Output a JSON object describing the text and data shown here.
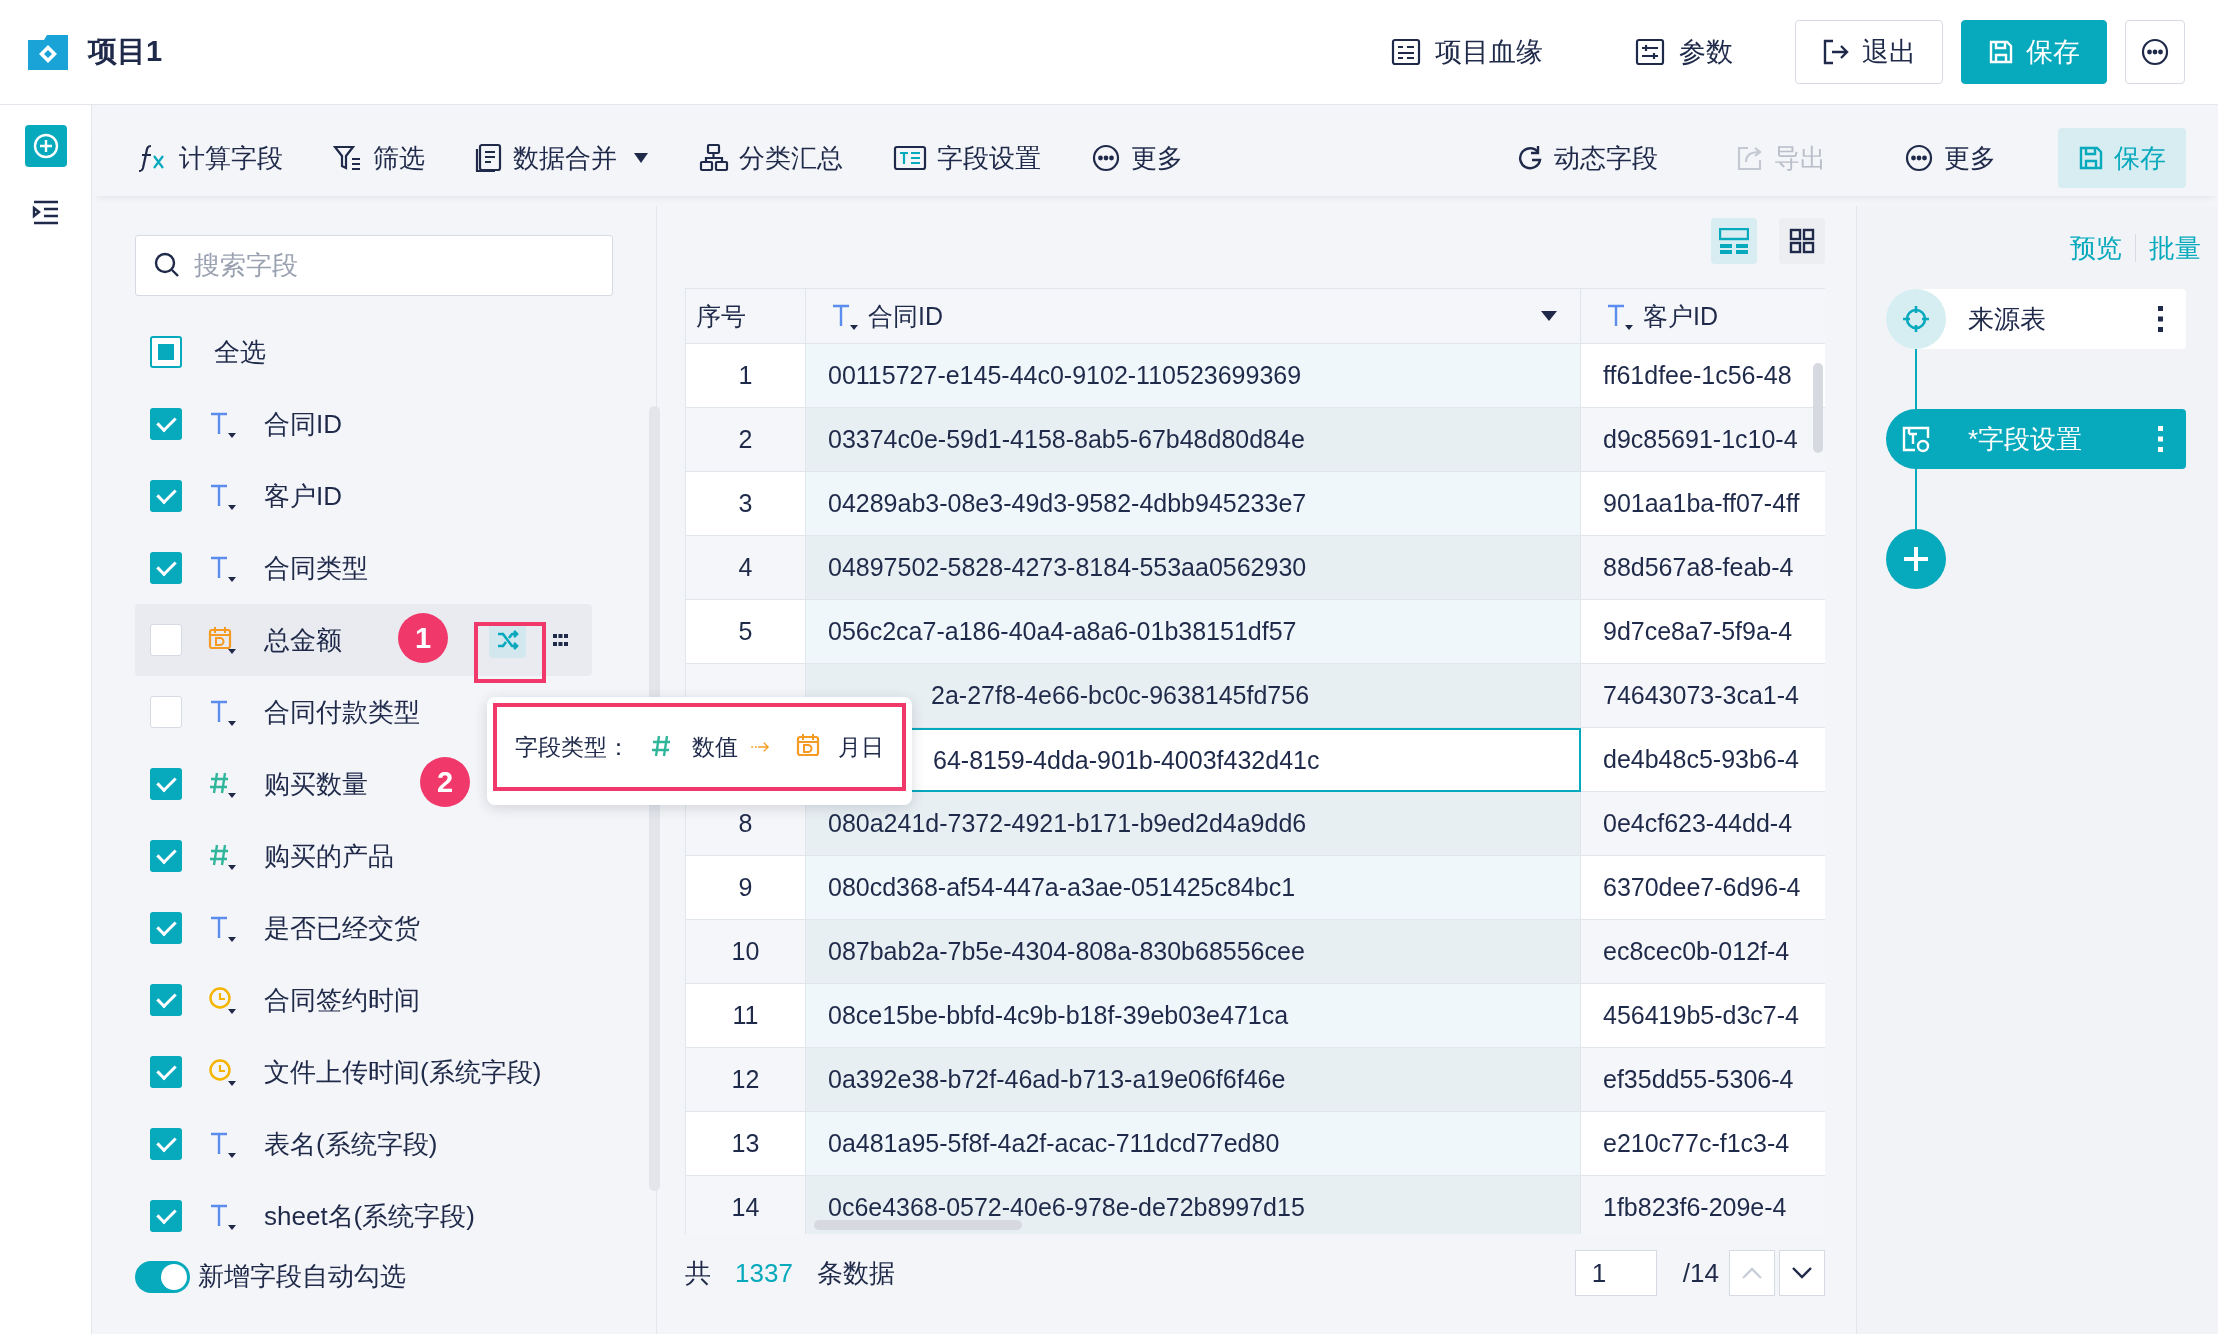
{
  "header": {
    "title": "项目1",
    "links": [
      {
        "label": "项目血缘",
        "kind": "lineage"
      },
      {
        "label": "参数",
        "kind": "params"
      }
    ],
    "buttons": [
      {
        "label": "退出",
        "kind": "exit"
      },
      {
        "label": "保存",
        "kind": "save"
      }
    ]
  },
  "toolbar": {
    "left": [
      {
        "label": "计算字段",
        "kind": "formula",
        "dropdown": false
      },
      {
        "label": "筛选",
        "kind": "filter",
        "dropdown": false
      },
      {
        "label": "数据合并",
        "kind": "merge",
        "dropdown": true
      },
      {
        "label": "分类汇总",
        "kind": "group",
        "dropdown": false
      },
      {
        "label": "字段设置",
        "kind": "fields",
        "dropdown": false
      },
      {
        "label": "更多",
        "kind": "more",
        "dropdown": false
      }
    ],
    "right": [
      {
        "label": "动态字段",
        "kind": "dynamic",
        "disabled": false
      },
      {
        "label": "导出",
        "kind": "export",
        "disabled": true
      },
      {
        "label": "更多",
        "kind": "more",
        "disabled": false
      },
      {
        "label": "保存",
        "kind": "save",
        "disabled": false
      }
    ]
  },
  "fields_panel": {
    "search": {
      "placeholder": "搜索字段"
    },
    "select_all": {
      "label": "全选",
      "checked": false,
      "indeterminate": true
    },
    "fields": [
      {
        "label": "合同ID",
        "kind": "text",
        "checked": true,
        "hovered": false
      },
      {
        "label": "客户ID",
        "kind": "text",
        "checked": true,
        "hovered": false
      },
      {
        "label": "合同类型",
        "kind": "text",
        "checked": true,
        "hovered": false
      },
      {
        "label": "总金额",
        "kind": "date",
        "checked": false,
        "hovered": true
      },
      {
        "label": "合同付款类型",
        "kind": "text",
        "checked": false,
        "hovered": false
      },
      {
        "label": "购买数量",
        "kind": "number",
        "checked": true,
        "hovered": false
      },
      {
        "label": "购买的产品",
        "kind": "number",
        "checked": true,
        "hovered": false
      },
      {
        "label": "是否已经交货",
        "kind": "text",
        "checked": true,
        "hovered": false
      },
      {
        "label": "合同签约时间",
        "kind": "time",
        "checked": true,
        "hovered": false
      },
      {
        "label": "文件上传时间(系统字段)",
        "kind": "time",
        "checked": true,
        "hovered": false
      },
      {
        "label": "表名(系统字段)",
        "kind": "text",
        "checked": true,
        "hovered": false
      },
      {
        "label": "sheet名(系统字段)",
        "kind": "text",
        "checked": true,
        "hovered": false
      }
    ],
    "auto_select": {
      "label": "新增字段自动勾选",
      "on": true
    }
  },
  "table": {
    "columns": [
      {
        "label": "序号",
        "kind": "index"
      },
      {
        "label": "合同ID",
        "kind": "text",
        "menu": true
      },
      {
        "label": "客户ID",
        "kind": "text",
        "menu": false
      }
    ],
    "rows": [
      {
        "no": "1",
        "contract_id": "00115727-e145-44c0-9102-110523699369",
        "customer_id": "ff61dfee-1c56-48",
        "selected": false
      },
      {
        "no": "2",
        "contract_id": "03374c0e-59d1-4158-8ab5-67b48d80d84e",
        "customer_id": "d9c85691-1c10-4",
        "selected": false
      },
      {
        "no": "3",
        "contract_id": "04289ab3-08e3-49d3-9582-4dbb945233e7",
        "customer_id": "901aa1ba-ff07-4ff",
        "selected": false
      },
      {
        "no": "4",
        "contract_id": "04897502-5828-4273-8184-553aa0562930",
        "customer_id": "88d567a8-feab-4",
        "selected": false
      },
      {
        "no": "5",
        "contract_id": "056c2ca7-a186-40a4-a8a6-01b38151df57",
        "customer_id": "9d7ce8a7-5f9a-4",
        "selected": false
      },
      {
        "contract_id": "2a-27f8-4e66-bc0c-9638145fd756",
        "customer_id": "74643073-3ca1-4",
        "selected": false
      },
      {
        "contract_id": "64-8159-4dda-901b-4003f432d41c",
        "customer_id": "de4b48c5-93b6-4",
        "selected": true
      },
      {
        "no": "8",
        "contract_id": "080a241d-7372-4921-b171-b9ed2d4a9dd6",
        "customer_id": "0e4cf623-44dd-4",
        "selected": false
      },
      {
        "no": "9",
        "contract_id": "080cd368-af54-447a-a3ae-051425c84bc1",
        "customer_id": "6370dee7-6d96-4",
        "selected": false
      },
      {
        "no": "10",
        "contract_id": "087bab2a-7b5e-4304-808a-830b68556cee",
        "customer_id": "ec8cec0b-012f-4",
        "selected": false
      },
      {
        "no": "11",
        "contract_id": "08ce15be-bbfd-4c9b-b18f-39eb03e471ca",
        "customer_id": "456419b5-d3c7-4",
        "selected": false
      },
      {
        "no": "12",
        "contract_id": "0a392e38-b72f-46ad-b713-a19e06f6f46e",
        "customer_id": "ef35dd55-5306-4",
        "selected": false
      },
      {
        "no": "13",
        "contract_id": "0a481a95-5f8f-4a2f-acac-711dcd77ed80",
        "customer_id": "e210c77c-f1c3-4",
        "selected": false
      },
      {
        "no": "14",
        "contract_id": "0c6e4368-0572-40e6-978e-de72b8997d15",
        "customer_id": "1fb823f6-209e-4",
        "selected": false
      }
    ]
  },
  "footer": {
    "prefix": "共",
    "total": "1337",
    "suffix": "条数据",
    "page": "1",
    "pages": "/14",
    "prev_disabled": true
  },
  "flow": {
    "links": [
      "预览",
      "批量"
    ],
    "nodes": [
      {
        "label": "来源表",
        "kind": "source",
        "selected": false
      },
      {
        "label": "*字段设置",
        "kind": "fields",
        "selected": true
      }
    ]
  },
  "popup": {
    "label": "字段类型：",
    "from": {
      "kind": "number",
      "label": "数值"
    },
    "to": {
      "kind": "date",
      "label": "月日"
    }
  },
  "annotations": [
    {
      "label": "1"
    },
    {
      "label": "2"
    }
  ]
}
